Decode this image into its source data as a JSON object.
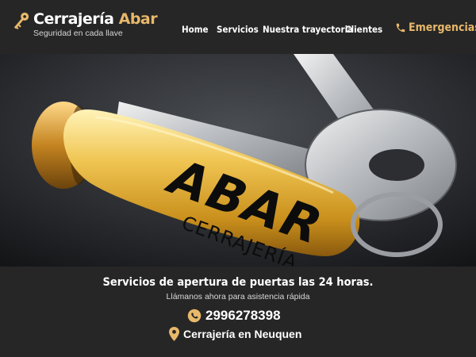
{
  "brand": {
    "name_main": "Cerrajería",
    "name_accent": "Abar",
    "tagline": "Seguridad en cada llave",
    "icon": "key-icon"
  },
  "nav": {
    "items": [
      {
        "label": "Home"
      },
      {
        "label": "Servicios"
      },
      {
        "label": "Nuestra trayectoria"
      },
      {
        "label": "Clientes"
      }
    ],
    "emergency": {
      "label": "Emergencias",
      "icon": "phone-icon"
    }
  },
  "hero": {
    "logo_text": "ABAR",
    "logo_subtext": "CERRAJERÍA"
  },
  "contact": {
    "headline": "Servicios de apertura de puertas las 24 horas.",
    "subtext": "Llámanos ahora para asistencia rápida",
    "phone": "2996278398",
    "phone_icon": "whatsapp-icon",
    "location": "Cerrajería en Neuquen",
    "location_icon": "map-pin-icon"
  },
  "colors": {
    "background": "#262626",
    "accent": "#e8b86a",
    "text": "#ffffff"
  }
}
